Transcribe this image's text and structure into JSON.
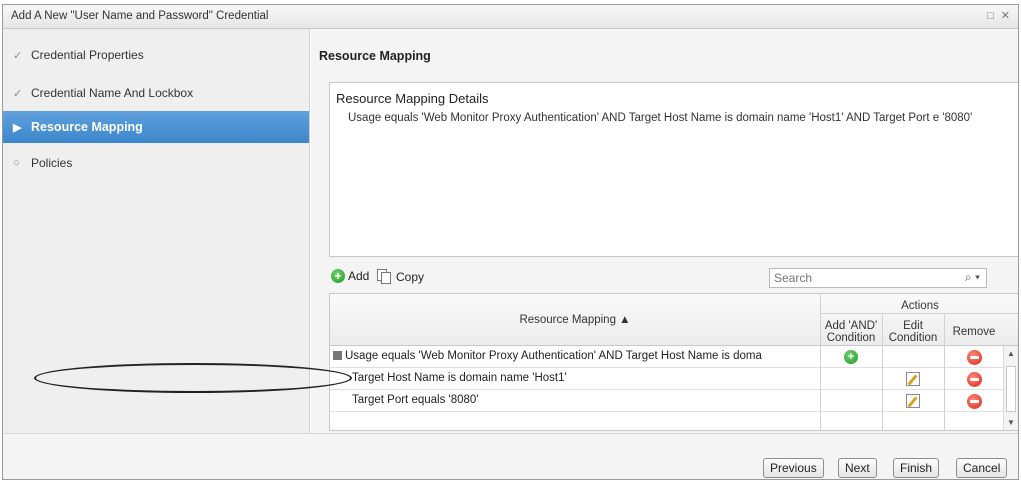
{
  "window": {
    "title": "Add A New \"User Name and Password\" Credential",
    "controls": "□ ✕"
  },
  "nav": {
    "items": [
      {
        "label": "Credential Properties",
        "mark": "✓",
        "active": false
      },
      {
        "label": "Credential Name And Lockbox",
        "mark": "✓",
        "active": false
      },
      {
        "label": "Resource Mapping",
        "mark": "▶",
        "active": true
      },
      {
        "label": "Policies",
        "mark": "○",
        "active": false
      }
    ]
  },
  "main": {
    "section_title": "Resource Mapping",
    "details_title": "Resource Mapping Details",
    "details_text": "Usage equals 'Web Monitor Proxy Authentication' AND Target Host Name is domain name 'Host1' AND Target Port e '8080'"
  },
  "toolbar": {
    "add_label": "Add",
    "copy_label": "Copy",
    "search_placeholder": "Search",
    "search_icon": "⌕ ▾"
  },
  "grid": {
    "col_resource": "Resource Mapping ▲",
    "actions_group": "Actions",
    "col_add": "Add 'AND' Condition",
    "col_edit": "Edit Condition",
    "col_remove": "Remove",
    "rows": [
      {
        "text": "Usage equals 'Web Monitor Proxy Authentication' AND Target Host Name is doma",
        "level": 0,
        "add": true,
        "edit": false,
        "remove": true
      },
      {
        "text": "Target Host Name is domain name 'Host1'",
        "level": 1,
        "add": false,
        "edit": true,
        "remove": true
      },
      {
        "text": "Target Port equals '8080'",
        "level": 1,
        "add": false,
        "edit": true,
        "remove": true
      }
    ]
  },
  "footer": {
    "previous_label": "Previous",
    "next_label": "Next",
    "finish_label": "Finish",
    "cancel_label": "Cancel"
  },
  "colors": {
    "accent": "#3b86cc",
    "add_green": "#249a24",
    "remove_red": "#d9261a"
  }
}
